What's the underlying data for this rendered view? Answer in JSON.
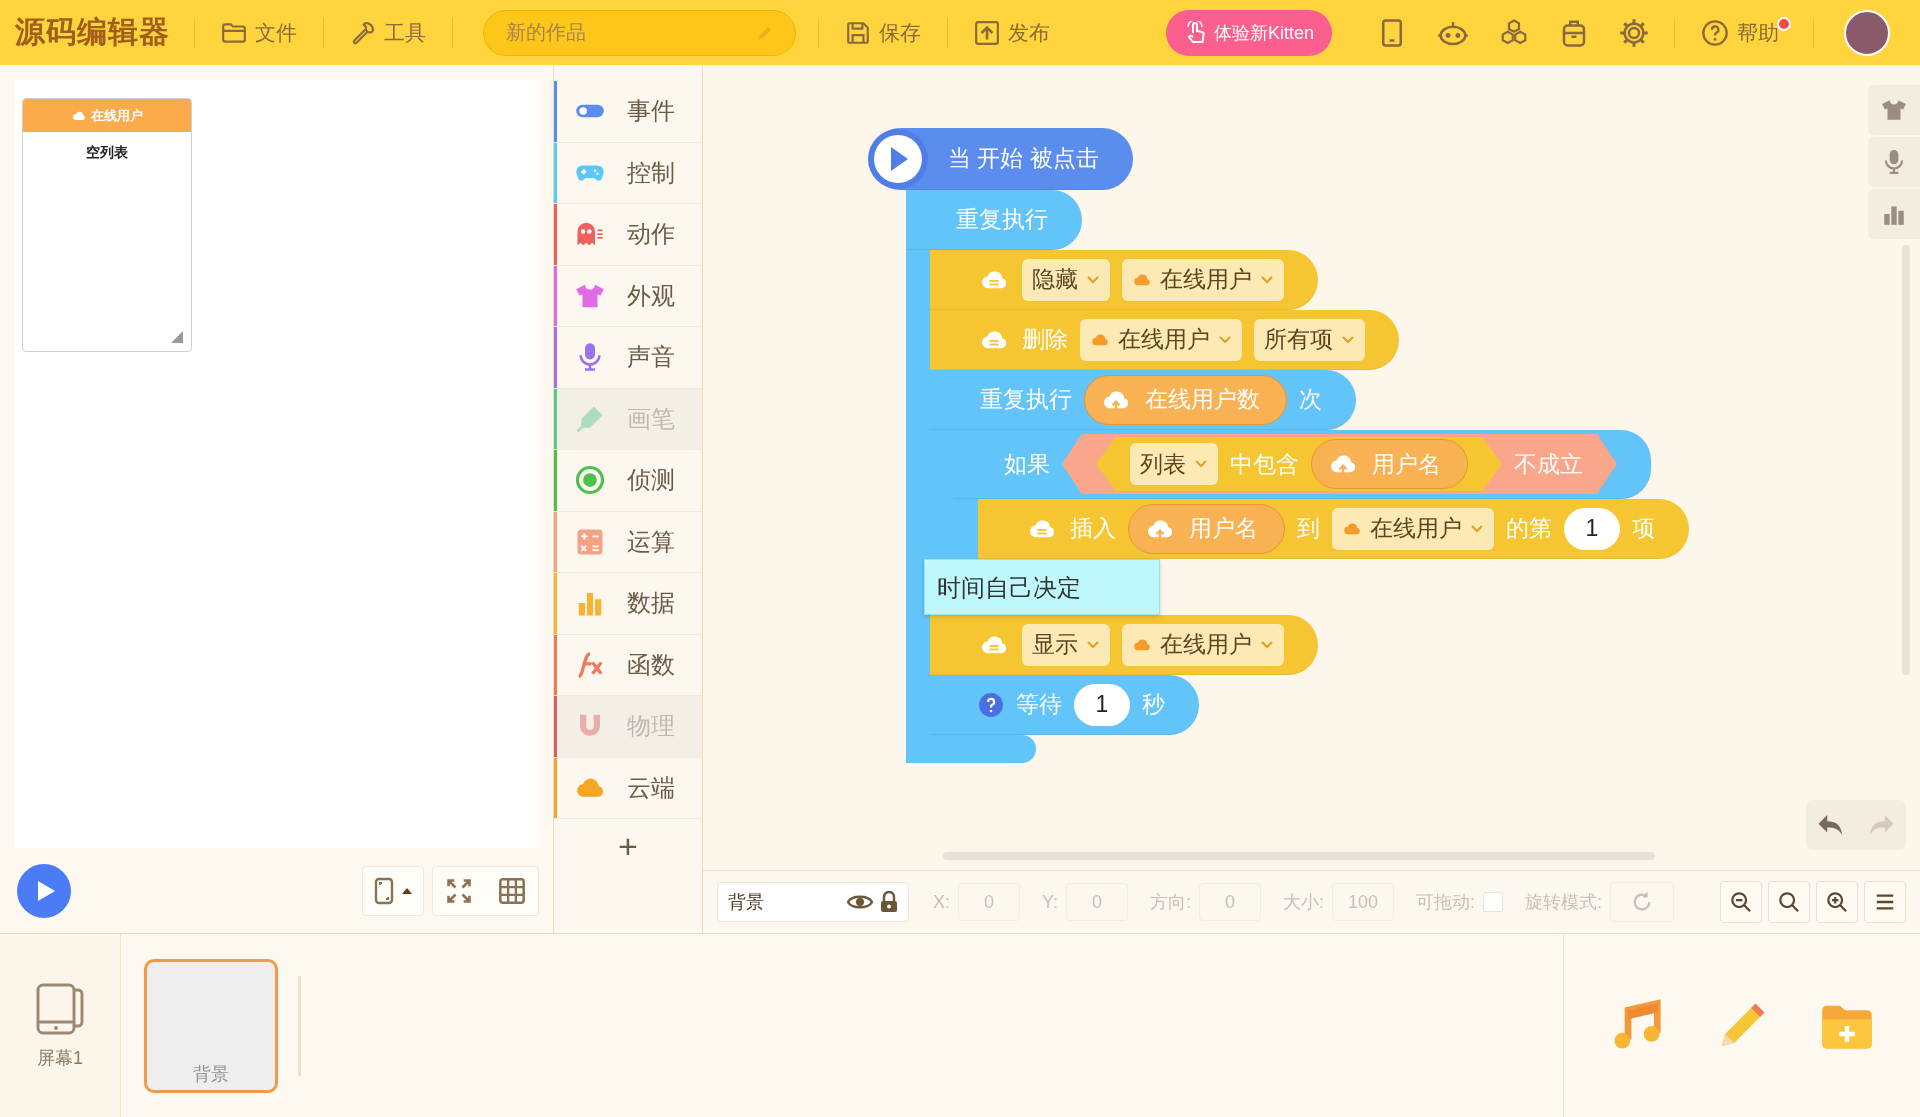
{
  "top_bar": {
    "logo": "源码编辑器",
    "menus": [
      {
        "label": "文件"
      },
      {
        "label": "工具"
      }
    ],
    "project_title": "新的作品",
    "actions": [
      {
        "label": "保存"
      },
      {
        "label": "发布"
      }
    ],
    "try_button": "体验新Kitten",
    "help": "帮助"
  },
  "list_monitor": {
    "title": "在线用户",
    "content": "空列表"
  },
  "categories": [
    {
      "label": "事件",
      "color": "#5b8def",
      "disabled": false
    },
    {
      "label": "控制",
      "color": "#5ac8fa",
      "disabled": false
    },
    {
      "label": "动作",
      "color": "#ef5f5f",
      "disabled": false
    },
    {
      "label": "外观",
      "color": "#e06ae6",
      "disabled": false
    },
    {
      "label": "声音",
      "color": "#9c72ee",
      "disabled": false
    },
    {
      "label": "画笔",
      "color": "#55c98f",
      "disabled": true
    },
    {
      "label": "侦测",
      "color": "#4cbf4c",
      "disabled": false
    },
    {
      "label": "运算",
      "color": "#f7a083",
      "disabled": false
    },
    {
      "label": "数据",
      "color": "#f6b431",
      "disabled": false
    },
    {
      "label": "函数",
      "color": "#f0785a",
      "disabled": false
    },
    {
      "label": "物理",
      "color": "#d9605f",
      "disabled": true
    },
    {
      "label": "云端",
      "color": "#f5a623",
      "disabled": false
    }
  ],
  "add_button": "+",
  "script": {
    "blocks": [
      {
        "kind": "hat",
        "color": "#5b8def",
        "tokens": [
          {
            "kind": "label",
            "text": "当 开始 被点击"
          }
        ]
      },
      {
        "kind": "c",
        "color": "#62c4f8",
        "tokens": [
          {
            "kind": "label",
            "text": "重复执行"
          }
        ],
        "body": [
          {
            "kind": "stack",
            "color": "#f6c632",
            "tokens": [
              {
                "kind": "list_icon"
              },
              {
                "kind": "dropdown",
                "text": "隐藏",
                "cloud_variable": false
              },
              {
                "kind": "dropdown",
                "text": "在线用户",
                "cloud_variable": true
              }
            ]
          },
          {
            "kind": "stack",
            "color": "#f6c632",
            "tokens": [
              {
                "kind": "list_icon"
              },
              {
                "kind": "label",
                "text": "删除"
              },
              {
                "kind": "dropdown",
                "text": "在线用户",
                "cloud_variable": true
              },
              {
                "kind": "dropdown",
                "text": "所有项",
                "cloud_variable": false
              }
            ]
          },
          {
            "kind": "c",
            "color": "#62c4f8",
            "comment": "时间自己决定",
            "tokens": [
              {
                "kind": "label",
                "text": "重复执行"
              },
              {
                "kind": "reporter",
                "text": "在线用户数"
              },
              {
                "kind": "label",
                "text": "次"
              }
            ],
            "body": [
              {
                "kind": "c",
                "color": "#62c4f8",
                "tokens": [
                  {
                    "kind": "label",
                    "text": "如果"
                  },
                  {
                    "kind": "hex",
                    "color": "#f9a68b",
                    "items": [
                      {
                        "kind": "hex",
                        "color": "#f6c632",
                        "items": [
                          {
                            "kind": "dropdown",
                            "text": "列表",
                            "cloud_variable": false
                          },
                          {
                            "kind": "label",
                            "text": "中包含"
                          },
                          {
                            "kind": "reporter",
                            "text": "用户名"
                          }
                        ]
                      },
                      {
                        "kind": "label",
                        "text": "不成立"
                      }
                    ]
                  }
                ],
                "body": [
                  {
                    "kind": "stack",
                    "color": "#f6c632",
                    "tokens": [
                      {
                        "kind": "list_icon"
                      },
                      {
                        "kind": "label",
                        "text": "插入"
                      },
                      {
                        "kind": "reporter",
                        "text": "用户名"
                      },
                      {
                        "kind": "label",
                        "text": "到"
                      },
                      {
                        "kind": "dropdown",
                        "text": "在线用户",
                        "cloud_variable": true
                      },
                      {
                        "kind": "label",
                        "text": "的第"
                      },
                      {
                        "kind": "number",
                        "text": "1"
                      },
                      {
                        "kind": "label",
                        "text": "项"
                      }
                    ]
                  }
                ]
              }
            ]
          },
          {
            "kind": "stack",
            "color": "#f6c632",
            "tokens": [
              {
                "kind": "list_icon"
              },
              {
                "kind": "dropdown",
                "text": "显示",
                "cloud_variable": false
              },
              {
                "kind": "dropdown",
                "text": "在线用户",
                "cloud_variable": true
              }
            ]
          },
          {
            "kind": "stack",
            "color": "#62c4f8",
            "tokens": [
              {
                "kind": "help_icon"
              },
              {
                "kind": "label",
                "text": "等待"
              },
              {
                "kind": "number",
                "text": "1"
              },
              {
                "kind": "label",
                "text": "秒"
              }
            ]
          }
        ]
      }
    ]
  },
  "properties": {
    "name": "背景",
    "fields": [
      {
        "label": "X:",
        "value": "0"
      },
      {
        "label": "Y:",
        "value": "0"
      },
      {
        "label": "方向:",
        "value": "0"
      },
      {
        "label": "大小:",
        "value": "100"
      }
    ],
    "draggable": {
      "label": "可拖动:",
      "checked": false
    },
    "rotation": {
      "label": "旋转模式:"
    }
  },
  "screens": [
    {
      "label": "屏幕1"
    }
  ],
  "backgrounds": [
    {
      "label": "背景",
      "selected": true
    }
  ]
}
